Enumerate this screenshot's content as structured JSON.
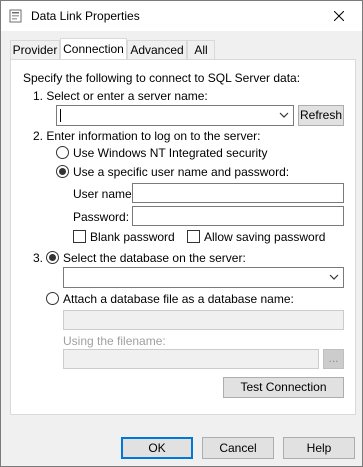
{
  "window": {
    "title": "Data Link Properties",
    "title_icon": "data-link-icon",
    "close_icon": "close-icon"
  },
  "tabs": [
    {
      "label": "Provider",
      "active": false
    },
    {
      "label": "Connection",
      "active": true
    },
    {
      "label": "Advanced",
      "active": false
    },
    {
      "label": "All",
      "active": false
    }
  ],
  "connection": {
    "intro": "Specify the following to connect to SQL Server data:",
    "step1_label": "1. Select or enter a server name:",
    "server_name_value": "",
    "refresh_label": "Refresh",
    "step2_label": "2. Enter information to log on to the server:",
    "nt_security_label": "Use Windows NT Integrated security",
    "nt_security_selected": false,
    "specific_user_label": "Use a specific user name and password:",
    "specific_user_selected": true,
    "user_name_label": "User name:",
    "user_name_value": "",
    "password_label": "Password:",
    "password_value": "",
    "blank_password_label": "Blank password",
    "blank_password_checked": false,
    "allow_saving_label": "Allow saving password",
    "allow_saving_checked": false,
    "step3_label": "3.",
    "select_db_label": "Select the database on the server:",
    "select_db_selected": true,
    "database_value": "",
    "attach_db_label": "Attach a database file as a database name:",
    "attach_db_selected": false,
    "attach_name_value": "",
    "using_filename_label": "Using the filename:",
    "filename_value": "",
    "browse_label": "...",
    "test_connection_label": "Test Connection"
  },
  "footer": {
    "ok_label": "OK",
    "cancel_label": "Cancel",
    "help_label": "Help"
  }
}
